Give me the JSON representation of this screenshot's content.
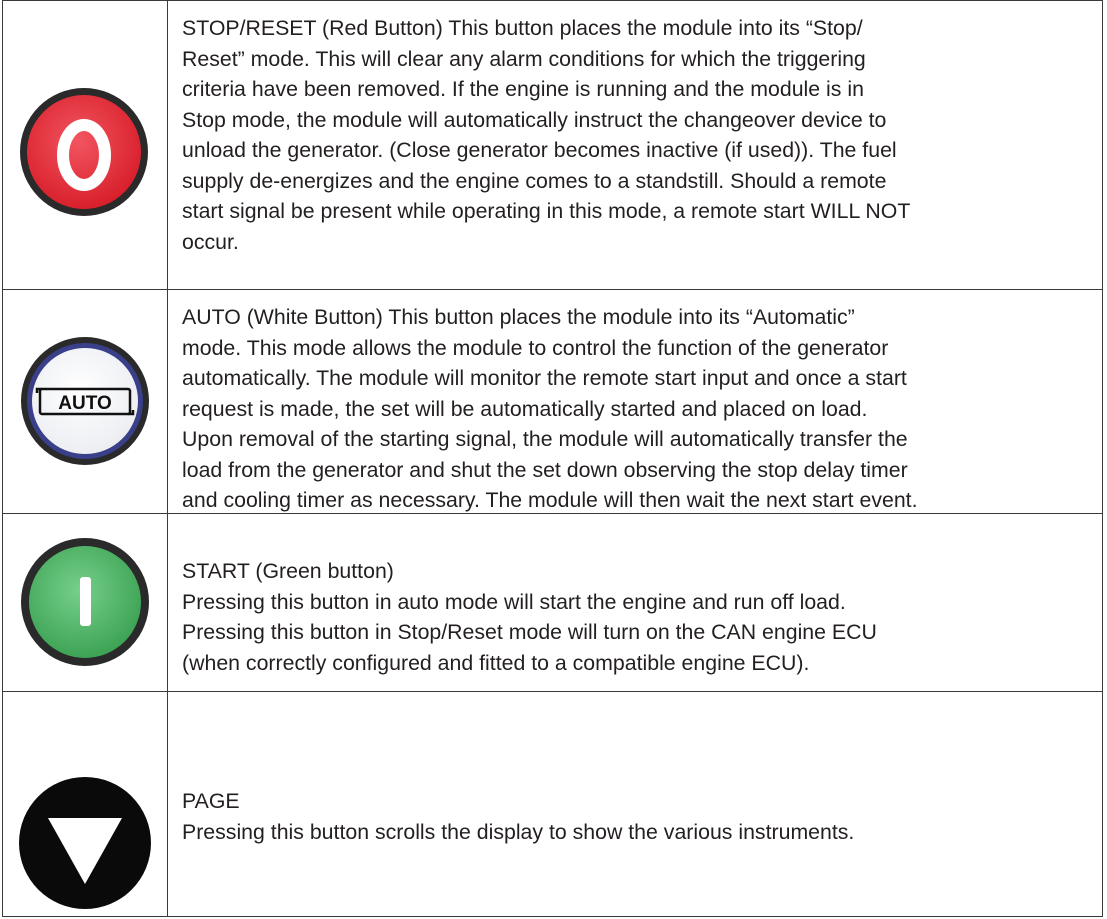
{
  "rows": [
    {
      "icon": "stop-reset-button-icon",
      "icon_color": "#e8303c",
      "glyph": "O",
      "text": "STOP/RESET (Red Button)  This button places the module into its “Stop/\nReset” mode.  This will clear any alarm conditions for which the triggering\ncriteria have been removed.  If the engine is running and the module is in\nStop mode, the module will automatically instruct the changeover device to\nunload the generator.  (Close generator becomes inactive (if used)).  The fuel\nsupply de-energizes and the engine comes to a standstill.  Should a remote\nstart signal be present while operating in this mode, a remote start WILL NOT\noccur."
    },
    {
      "icon": "auto-button-icon",
      "icon_color": "#ffffff",
      "glyph": "AUTO",
      "text": "AUTO (White Button)  This button places the module into its “Automatic”\nmode.  This mode allows the module to control the function of the generator\nautomatically.  The module will monitor the remote start input and once a start\nrequest is made, the set will be automatically started and placed on load.\nUpon removal of the starting signal, the module will automatically transfer the\nload from the generator and shut the set down observing the stop delay timer\nand cooling timer as necessary.  The module will then wait the next start event."
    },
    {
      "icon": "start-button-icon",
      "icon_color": "#5cc26e",
      "glyph": "I",
      "text": "START (Green button)\nPressing this button in auto mode will start the engine and run off load.\nPressing this button in Stop/Reset mode will turn on the CAN engine ECU\n(when correctly configured and fitted to a compatible engine ECU)."
    },
    {
      "icon": "page-button-icon",
      "icon_color": "#0a0a0a",
      "glyph": "",
      "text": "PAGE\nPressing this button scrolls the display to show the various instruments."
    }
  ]
}
